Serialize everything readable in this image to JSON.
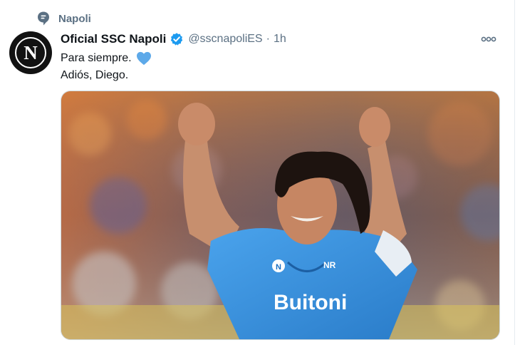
{
  "context": {
    "label": "Napoli",
    "icon": "topic-icon"
  },
  "tweet": {
    "avatar_letter": "N",
    "display_name": "Oficial SSC Napoli",
    "handle": "@sscnapoliES",
    "separator": "·",
    "time": "1h",
    "lines": [
      "Para siempre.",
      "Adiós, Diego."
    ],
    "emoji": "blue-heart",
    "media": {
      "jersey_text": "Buitoni"
    }
  },
  "colors": {
    "verified": "#1d9bf0",
    "heart": "#5da9e9",
    "muted": "#5b7083",
    "jersey": "#2f8bd8"
  }
}
